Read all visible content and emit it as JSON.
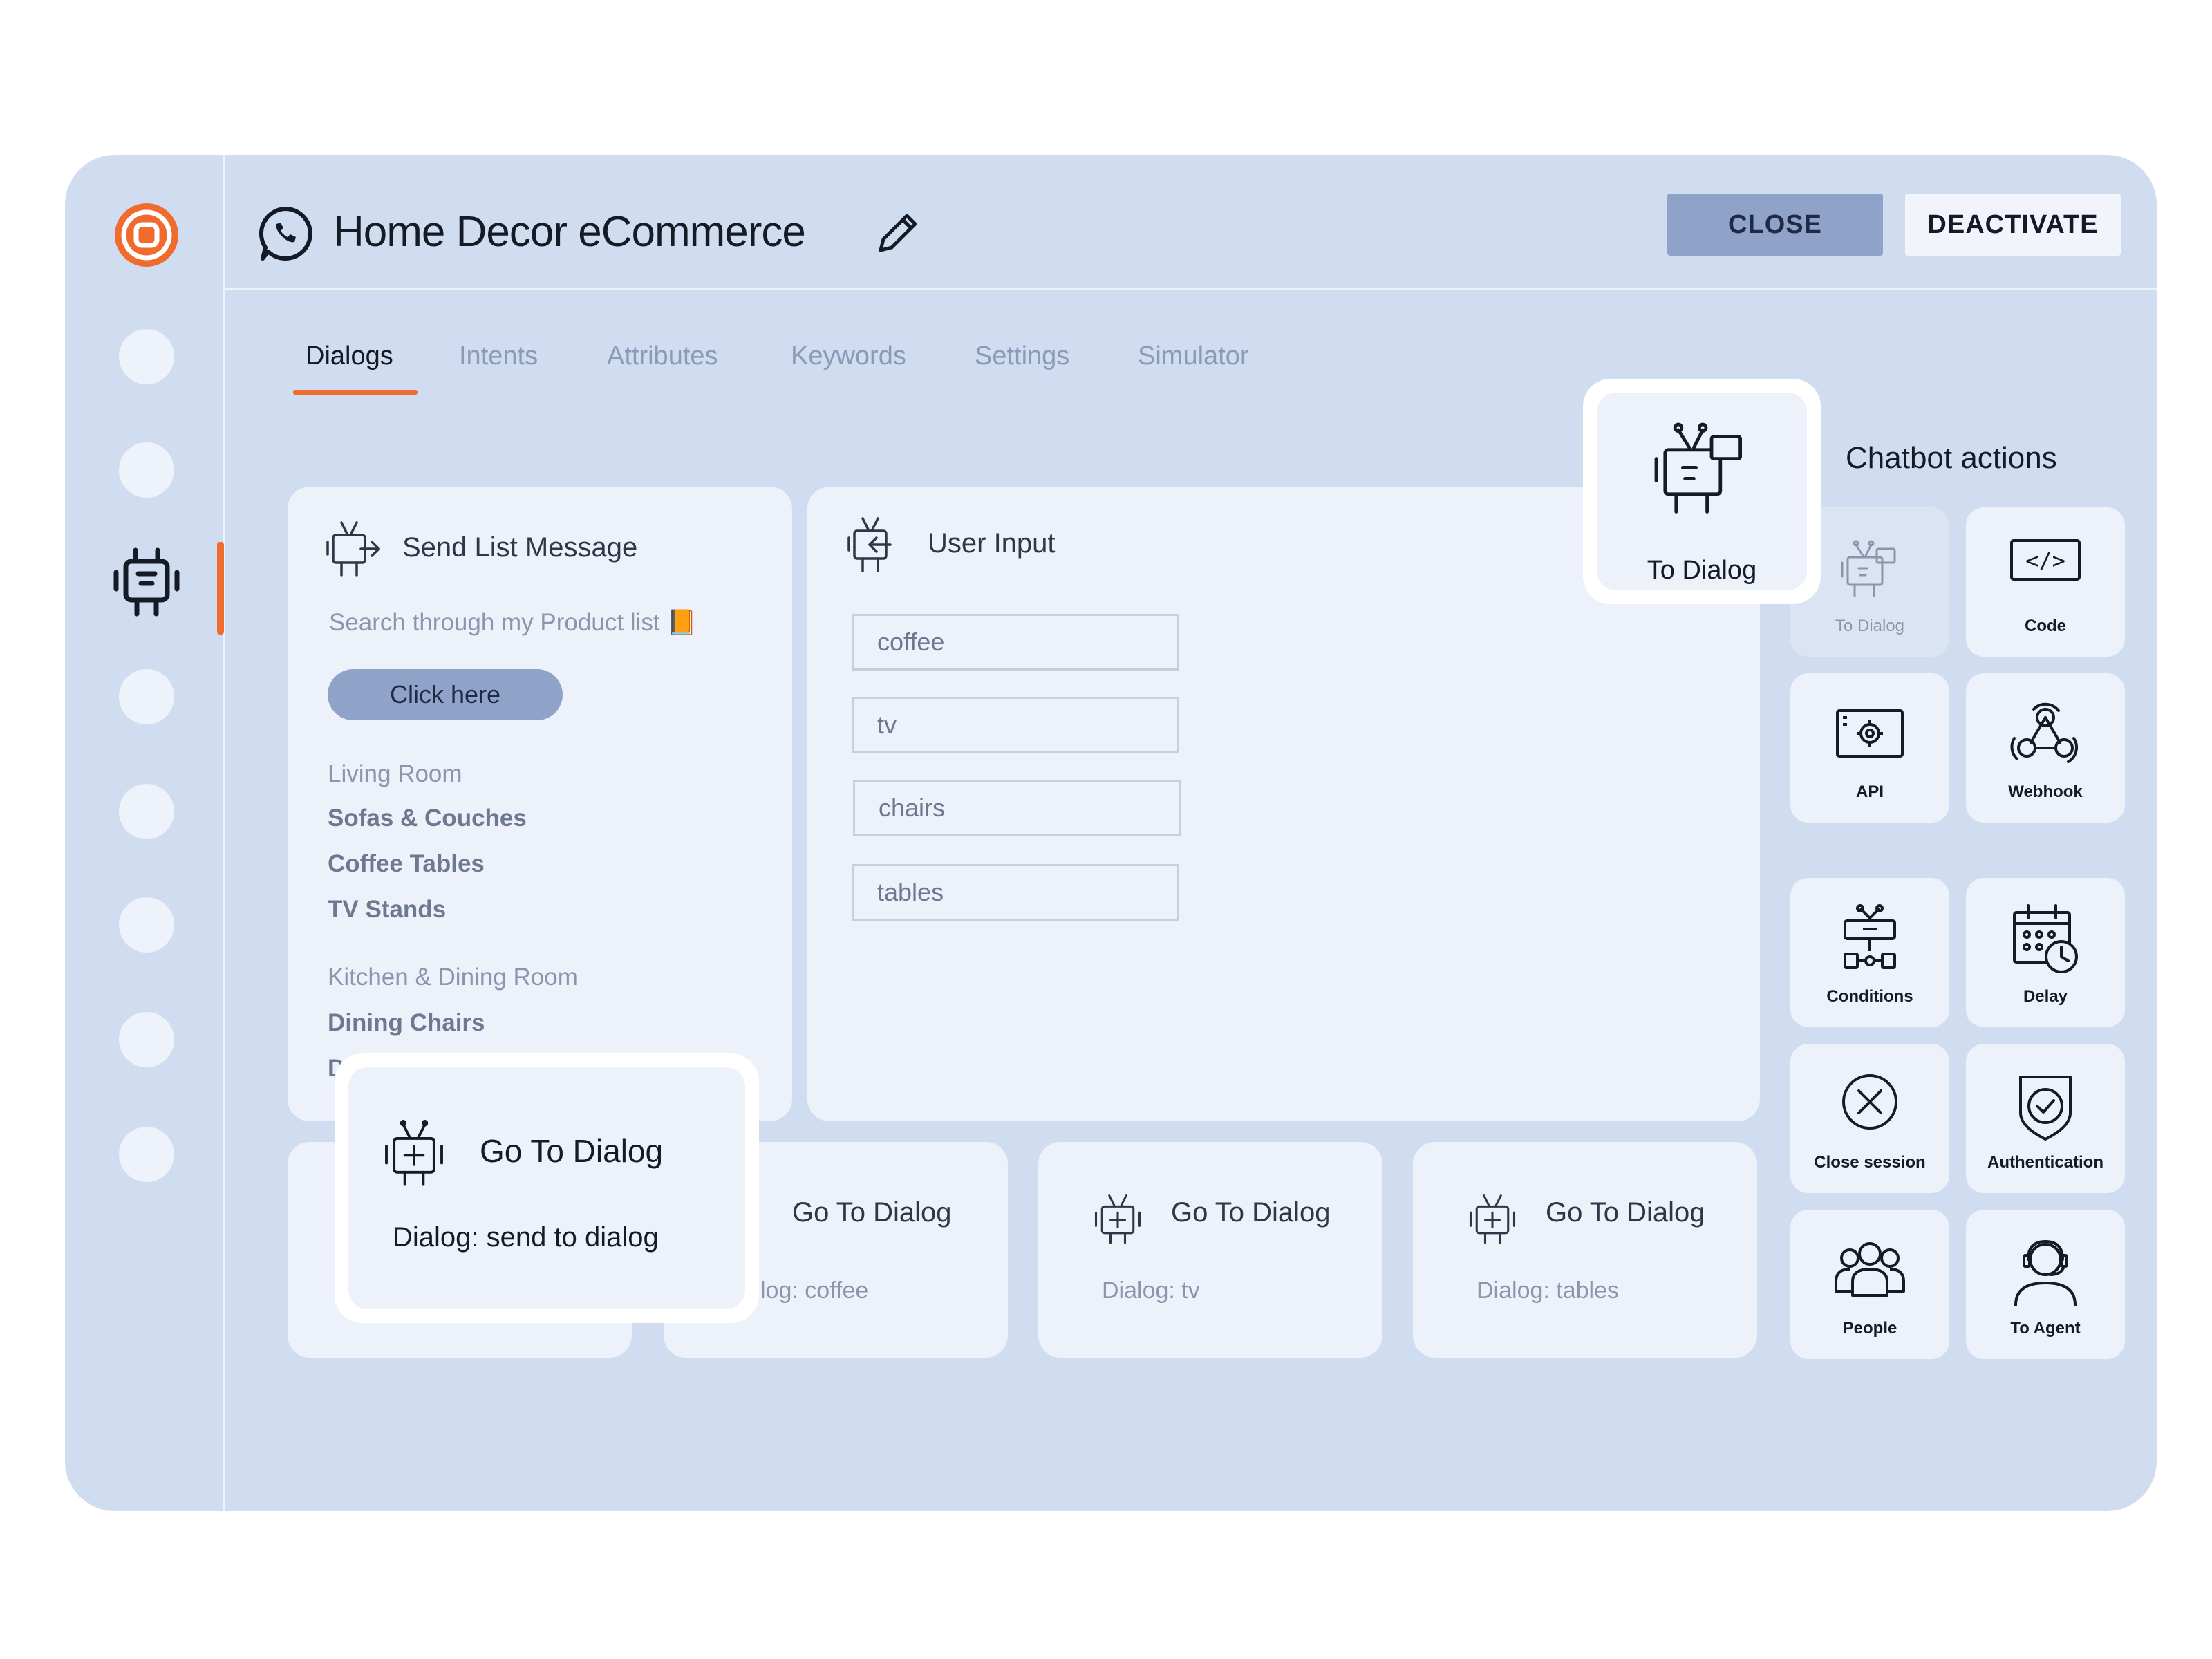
{
  "header": {
    "title": "Home Decor eCommerce",
    "close_label": "CLOSE",
    "deactivate_label": "DEACTIVATE"
  },
  "tabs": [
    "Dialogs",
    "Intents",
    "Attributes",
    "Keywords",
    "Settings",
    "Simulator"
  ],
  "active_tab": "Dialogs",
  "send_list": {
    "title": "Send List Message",
    "subtitle": "Search through my Product list 📙",
    "button": "Click here",
    "section1": "Living Room",
    "items1": [
      "Sofas & Couches",
      "Coffee Tables",
      "TV Stands"
    ],
    "section2": "Kitchen & Dining Room",
    "items2": [
      "Dining Chairs",
      "D"
    ]
  },
  "user_input": {
    "title": "User Input",
    "options": [
      "coffee",
      "tv",
      "chairs",
      "tables"
    ]
  },
  "go_cards": [
    {
      "title": "Go To Dialog",
      "sub": "log: coffee"
    },
    {
      "title": "Go To Dialog",
      "sub": "Dialog: tv"
    },
    {
      "title": "Go To Dialog",
      "sub": "Dialog: tables"
    }
  ],
  "float_go": {
    "title": "Go To Dialog",
    "sub": "Dialog: send to dialog"
  },
  "float_todialog": {
    "label": "To Dialog"
  },
  "chatbot_actions": {
    "title": "Chatbot actions",
    "tiles": [
      "To Dialog",
      "Code",
      "API",
      "Webhook",
      "Conditions",
      "Delay",
      "Close session",
      "Authentication",
      "People",
      "To Agent"
    ]
  },
  "colors": {
    "accent": "#f26b2e",
    "frame_bg": "#d0ddf0",
    "card_bg": "#ecf1fa",
    "button_bg": "#8fa2c8"
  },
  "icons": [
    "logo-icon",
    "whatsapp-icon",
    "pencil-icon",
    "robot-icon",
    "code-icon",
    "api-icon",
    "webhook-icon",
    "conditions-icon",
    "delay-icon",
    "close-session-icon",
    "authentication-icon",
    "people-icon",
    "to-agent-icon"
  ]
}
